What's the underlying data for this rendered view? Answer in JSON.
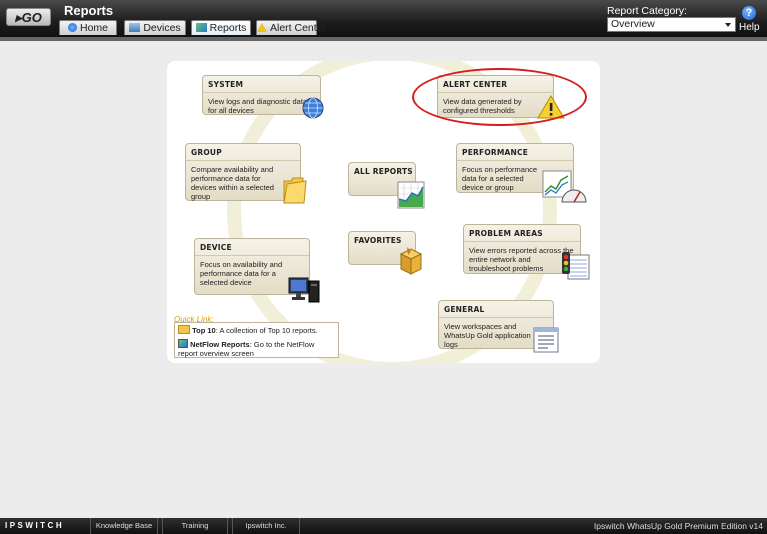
{
  "header": {
    "go_label": "▸GO",
    "title": "Reports",
    "tabs": [
      {
        "label": "Home",
        "icon": "home-icon",
        "active": false
      },
      {
        "label": "Devices",
        "icon": "devices-icon",
        "active": false
      },
      {
        "label": "Reports",
        "icon": "reports-icon",
        "active": true
      },
      {
        "label": "Alert Center",
        "icon": "alert-icon",
        "active": false
      }
    ],
    "report_category_label": "Report Category:",
    "report_category_value": "Overview",
    "help_symbol": "?",
    "help_label": "Help"
  },
  "cards": {
    "system": {
      "title": "SYSTEM",
      "desc": "View logs and diagnostic data for all devices",
      "icon": "globe-icon"
    },
    "alert_center": {
      "title": "ALERT CENTER",
      "desc": "View data generated by configured thresholds",
      "icon": "warning-icon"
    },
    "group": {
      "title": "GROUP",
      "desc": "Compare availability and performance data for devices within a selected group",
      "icon": "folder-icon"
    },
    "all_reports": {
      "title": "ALL REPORTS",
      "icon": "chart-icon"
    },
    "performance": {
      "title": "PERFORMANCE",
      "desc": "Focus on performance data for a selected device or group",
      "icon": "gauge-icon"
    },
    "favorites": {
      "title": "FAVORITES",
      "icon": "box-icon"
    },
    "problem_areas": {
      "title": "PROBLEM AREAS",
      "desc": "View errors reported across the entire network and troubleshoot problems",
      "icon": "traffic-light-icon"
    },
    "device": {
      "title": "DEVICE",
      "desc": "Focus on availability and performance data for a selected device",
      "icon": "computer-icon"
    },
    "general": {
      "title": "GENERAL",
      "desc": "View workspaces and WhatsUp Gold application logs",
      "icon": "document-icon"
    }
  },
  "quick_link": {
    "title": "Quick Link:",
    "top10_label": "Top 10",
    "top10_desc": ": A collection of Top 10 reports.",
    "netflow_label": "NetFlow Reports",
    "netflow_desc": ": Go to the NetFlow report overview screen"
  },
  "footer": {
    "logo": "IPSWITCH",
    "links": [
      "Knowledge Base",
      "Training",
      "Ipswitch Inc."
    ],
    "edition": "Ipswitch WhatsUp Gold Premium Edition v14"
  },
  "colors": {
    "highlight_circle": "#d81c1c",
    "card_bg": "#e8e2cc",
    "quick_link_title": "#d0a000"
  }
}
